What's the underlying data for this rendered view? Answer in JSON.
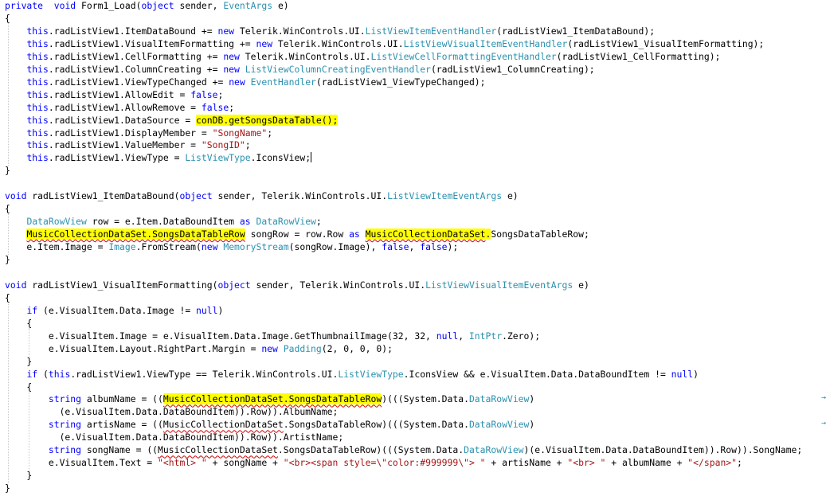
{
  "code_lines": [
    [
      [
        "kw",
        "private"
      ],
      [
        "",
        "  "
      ],
      [
        "kw",
        "void"
      ],
      [
        "",
        " Form1_Load("
      ],
      [
        "kw",
        "object"
      ],
      [
        "",
        " sender, "
      ],
      [
        "ty",
        "EventArgs"
      ],
      [
        "",
        " e)"
      ]
    ],
    [
      [
        "",
        "{"
      ]
    ],
    [
      [
        "",
        "    "
      ],
      [
        "kw",
        "this"
      ],
      [
        "",
        ".radListView1.ItemDataBound += "
      ],
      [
        "kw",
        "new"
      ],
      [
        "",
        " Telerik.WinControls.UI."
      ],
      [
        "ty",
        "ListViewItemEventHandler"
      ],
      [
        "",
        "(radListView1_ItemDataBound);"
      ]
    ],
    [
      [
        "",
        "    "
      ],
      [
        "kw",
        "this"
      ],
      [
        "",
        ".radListView1.VisualItemFormatting += "
      ],
      [
        "kw",
        "new"
      ],
      [
        "",
        " Telerik.WinControls.UI."
      ],
      [
        "ty",
        "ListViewVisualItemEventHandler"
      ],
      [
        "",
        "(radListView1_VisualItemFormatting);"
      ]
    ],
    [
      [
        "",
        "    "
      ],
      [
        "kw",
        "this"
      ],
      [
        "",
        ".radListView1.CellFormatting += "
      ],
      [
        "kw",
        "new"
      ],
      [
        "",
        " Telerik.WinControls.UI."
      ],
      [
        "ty",
        "ListViewCellFormattingEventHandler"
      ],
      [
        "",
        "(radListView1_CellFormatting);"
      ]
    ],
    [
      [
        "",
        "    "
      ],
      [
        "kw",
        "this"
      ],
      [
        "",
        ".radListView1.ColumnCreating += "
      ],
      [
        "kw",
        "new"
      ],
      [
        "",
        " "
      ],
      [
        "ty",
        "ListViewColumnCreatingEventHandler"
      ],
      [
        "",
        "(radListView1_ColumnCreating);"
      ]
    ],
    [
      [
        "",
        "    "
      ],
      [
        "kw",
        "this"
      ],
      [
        "",
        ".radListView1.ViewTypeChanged += "
      ],
      [
        "kw",
        "new"
      ],
      [
        "",
        " "
      ],
      [
        "ty",
        "EventHandler"
      ],
      [
        "",
        "(radListView1_ViewTypeChanged);"
      ]
    ],
    [
      [
        "",
        "    "
      ],
      [
        "kw",
        "this"
      ],
      [
        "",
        ".radListView1.AllowEdit = "
      ],
      [
        "kw",
        "false"
      ],
      [
        "",
        ";"
      ]
    ],
    [
      [
        "",
        "    "
      ],
      [
        "kw",
        "this"
      ],
      [
        "",
        ".radListView1.AllowRemove = "
      ],
      [
        "kw",
        "false"
      ],
      [
        "",
        ";"
      ]
    ],
    [
      [
        "",
        "    "
      ],
      [
        "kw",
        "this"
      ],
      [
        "",
        ".radListView1.DataSource = "
      ],
      [
        "hl",
        "conDB.getSongsDataTable();"
      ]
    ],
    [
      [
        "",
        "    "
      ],
      [
        "kw",
        "this"
      ],
      [
        "",
        ".radListView1.DisplayMember = "
      ],
      [
        "st",
        "\"SongName\""
      ],
      [
        "",
        ";"
      ]
    ],
    [
      [
        "",
        "    "
      ],
      [
        "kw",
        "this"
      ],
      [
        "",
        ".radListView1.ValueMember = "
      ],
      [
        "st",
        "\"SongID\""
      ],
      [
        "",
        ";"
      ]
    ],
    [
      [
        "",
        "    "
      ],
      [
        "kw",
        "this"
      ],
      [
        "",
        ".radListView1.ViewType = "
      ],
      [
        "ty",
        "ListViewType"
      ],
      [
        "",
        ".IconsView;"
      ],
      [
        "caret",
        ""
      ]
    ],
    [
      [
        "",
        "}"
      ]
    ],
    [
      [
        "",
        ""
      ]
    ],
    [
      [
        "kw",
        "void"
      ],
      [
        "",
        " radListView1_ItemDataBound("
      ],
      [
        "kw",
        "object"
      ],
      [
        "",
        " sender, Telerik.WinControls.UI."
      ],
      [
        "ty",
        "ListViewItemEventArgs"
      ],
      [
        "",
        " e)"
      ]
    ],
    [
      [
        "",
        "{"
      ]
    ],
    [
      [
        "",
        "    "
      ],
      [
        "ty",
        "DataRowView"
      ],
      [
        "",
        " row = e.Item.DataBoundItem "
      ],
      [
        "kw",
        "as"
      ],
      [
        "",
        " "
      ],
      [
        "ty",
        "DataRowView"
      ],
      [
        "",
        ";"
      ]
    ],
    [
      [
        "",
        "    "
      ],
      [
        "hlsq",
        "MusicCollectionDataSet.SongsDataTableRow"
      ],
      [
        "",
        " songRow = row.Row "
      ],
      [
        "kw",
        "as"
      ],
      [
        "",
        " "
      ],
      [
        "hlsq",
        "MusicCollectionDataSet"
      ],
      [
        "hl",
        "."
      ],
      [
        "",
        "SongsDataTableRow;"
      ]
    ],
    [
      [
        "",
        "    e.Item.Image = "
      ],
      [
        "ty",
        "Image"
      ],
      [
        "",
        ".FromStream("
      ],
      [
        "kw",
        "new"
      ],
      [
        "",
        " "
      ],
      [
        "ty",
        "MemoryStream"
      ],
      [
        "",
        "(songRow.Image), "
      ],
      [
        "kw",
        "false"
      ],
      [
        "",
        ", "
      ],
      [
        "kw",
        "false"
      ],
      [
        "",
        ");"
      ]
    ],
    [
      [
        "",
        "}"
      ]
    ],
    [
      [
        "",
        ""
      ]
    ],
    [
      [
        "kw",
        "void"
      ],
      [
        "",
        " radListView1_VisualItemFormatting("
      ],
      [
        "kw",
        "object"
      ],
      [
        "",
        " sender, Telerik.WinControls.UI."
      ],
      [
        "ty",
        "ListViewVisualItemEventArgs"
      ],
      [
        "",
        " e)"
      ]
    ],
    [
      [
        "",
        "{"
      ]
    ],
    [
      [
        "",
        "    "
      ],
      [
        "kw",
        "if"
      ],
      [
        "",
        " (e.VisualItem.Data.Image != "
      ],
      [
        "kw",
        "null"
      ],
      [
        "",
        ")"
      ]
    ],
    [
      [
        "",
        "    {"
      ]
    ],
    [
      [
        "",
        "        e.VisualItem.Image = e.VisualItem.Data.Image.GetThumbnailImage(32, 32, "
      ],
      [
        "kw",
        "null"
      ],
      [
        "",
        ", "
      ],
      [
        "ty",
        "IntPtr"
      ],
      [
        "",
        ".Zero);"
      ]
    ],
    [
      [
        "",
        "        e.VisualItem.Layout.RightPart.Margin = "
      ],
      [
        "kw",
        "new"
      ],
      [
        "",
        " "
      ],
      [
        "ty",
        "Padding"
      ],
      [
        "",
        "(2, 0, 0, 0);"
      ]
    ],
    [
      [
        "",
        "    }"
      ]
    ],
    [
      [
        "",
        "    "
      ],
      [
        "kw",
        "if"
      ],
      [
        "",
        " ("
      ],
      [
        "kw",
        "this"
      ],
      [
        "",
        ".radListView1.ViewType == Telerik.WinControls.UI."
      ],
      [
        "ty",
        "ListViewType"
      ],
      [
        "",
        ".IconsView && e.VisualItem.Data.DataBoundItem != "
      ],
      [
        "kw",
        "null"
      ],
      [
        "",
        ")"
      ]
    ],
    [
      [
        "",
        "    {"
      ]
    ],
    [
      [
        "",
        "        "
      ],
      [
        "kw",
        "string"
      ],
      [
        "",
        " albumName = (("
      ],
      [
        "hlsq",
        "MusicCollectionDataSet.SongsDataTableRow"
      ],
      [
        "",
        ")((("
      ],
      [
        "",
        "System.Data."
      ],
      [
        "ty",
        "DataRowView"
      ],
      [
        "",
        ")"
      ]
    ],
    [
      [
        "",
        "          (e.VisualItem.Data.DataBoundItem)).Row)).AlbumName;"
      ]
    ],
    [
      [
        "",
        "        "
      ],
      [
        "kw",
        "string"
      ],
      [
        "",
        " artisName = (("
      ],
      [
        "sq",
        "MusicCollectionDataSet"
      ],
      [
        "",
        ".SongsDataTableRow)((("
      ],
      [
        "",
        "System.Data."
      ],
      [
        "ty",
        "DataRowView"
      ],
      [
        "",
        ")"
      ]
    ],
    [
      [
        "",
        "          (e.VisualItem.Data.DataBoundItem)).Row)).ArtistName;"
      ]
    ],
    [
      [
        "",
        "        "
      ],
      [
        "kw",
        "string"
      ],
      [
        "",
        " songName = (("
      ],
      [
        "sq",
        "MusicCollectionDataSet"
      ],
      [
        "",
        ".SongsDataTableRow)((("
      ],
      [
        "",
        "System.Data."
      ],
      [
        "ty",
        "DataRowView"
      ],
      [
        "",
        ")(e.VisualItem.Data.DataBoundItem)).Row)).SongName;"
      ]
    ],
    [
      [
        "",
        "        e.VisualItem.Text = "
      ],
      [
        "st",
        "\"<html> \""
      ],
      [
        "",
        " + songName + "
      ],
      [
        "st",
        "\"<br><span style=\\\"color:#999999\\\"> \""
      ],
      [
        "",
        " + artisName + "
      ],
      [
        "st",
        "\"<br> \""
      ],
      [
        "",
        " + albumName + "
      ],
      [
        "st",
        "\"</span>\""
      ],
      [
        "",
        ";"
      ]
    ],
    [
      [
        "",
        "    }"
      ]
    ],
    [
      [
        "",
        "}"
      ]
    ]
  ]
}
